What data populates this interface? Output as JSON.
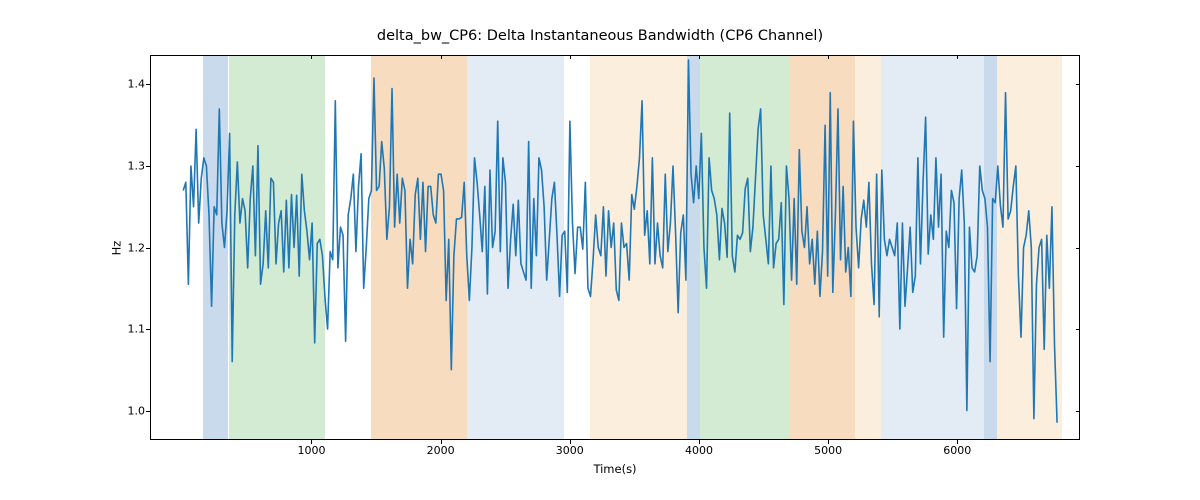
{
  "chart_data": {
    "type": "line",
    "title": "delta_bw_CP6: Delta Instantaneous Bandwidth (CP6 Channel)",
    "xlabel": "Time(s)",
    "ylabel": "Hz",
    "xlim": [
      -250,
      6950
    ],
    "ylim": [
      0.965,
      1.435
    ],
    "xticks": [
      1000,
      2000,
      3000,
      4000,
      5000,
      6000
    ],
    "yticks": [
      1.0,
      1.1,
      1.2,
      1.3,
      1.4
    ],
    "bands": [
      {
        "x0": 150,
        "x1": 350,
        "color": "#c9daec",
        "label": "blue"
      },
      {
        "x0": 350,
        "x1": 1100,
        "color": "#d3ead3",
        "label": "green"
      },
      {
        "x0": 1450,
        "x1": 2200,
        "color": "#f8dcc0",
        "label": "orange"
      },
      {
        "x0": 2200,
        "x1": 2950,
        "color": "#e3ebf4",
        "label": "lightblue"
      },
      {
        "x0": 3150,
        "x1": 3900,
        "color": "#fbeedd",
        "label": "peach"
      },
      {
        "x0": 3900,
        "x1": 4000,
        "color": "#c9daec",
        "label": "blue"
      },
      {
        "x0": 4000,
        "x1": 4700,
        "color": "#d3ead3",
        "label": "green"
      },
      {
        "x0": 4700,
        "x1": 5200,
        "color": "#f8dcc0",
        "label": "orange"
      },
      {
        "x0": 5200,
        "x1": 5400,
        "color": "#fbeedd",
        "label": "peach"
      },
      {
        "x0": 5400,
        "x1": 6200,
        "color": "#e3ebf4",
        "label": "lightblue"
      },
      {
        "x0": 6200,
        "x1": 6300,
        "color": "#c9daec",
        "label": "blue"
      },
      {
        "x0": 6300,
        "x1": 6800,
        "color": "#fbeedd",
        "label": "peach"
      }
    ],
    "series": [
      {
        "name": "delta_bw_CP6",
        "color": "#1f77b4",
        "x_start": 0,
        "x_step": 20,
        "values": [
          1.27,
          1.28,
          1.155,
          1.3,
          1.25,
          1.345,
          1.23,
          1.285,
          1.31,
          1.3,
          1.24,
          1.128,
          1.25,
          1.24,
          1.37,
          1.23,
          1.2,
          1.245,
          1.34,
          1.06,
          1.24,
          1.305,
          1.23,
          1.26,
          1.245,
          1.175,
          1.26,
          1.3,
          1.19,
          1.325,
          1.155,
          1.18,
          1.245,
          1.175,
          1.285,
          1.28,
          1.18,
          1.23,
          1.245,
          1.17,
          1.258,
          1.175,
          1.265,
          1.2,
          1.264,
          1.165,
          1.29,
          1.245,
          1.22,
          1.185,
          1.23,
          1.083,
          1.205,
          1.21,
          1.19,
          1.138,
          1.1,
          1.195,
          1.185,
          1.38,
          1.175,
          1.225,
          1.215,
          1.085,
          1.24,
          1.26,
          1.29,
          1.195,
          1.275,
          1.315,
          1.15,
          1.2,
          1.26,
          1.27,
          1.408,
          1.27,
          1.275,
          1.33,
          1.297,
          1.21,
          1.25,
          1.395,
          1.225,
          1.29,
          1.23,
          1.285,
          1.27,
          1.15,
          1.21,
          1.18,
          1.265,
          1.285,
          1.21,
          1.28,
          1.195,
          1.275,
          1.275,
          1.24,
          1.23,
          1.29,
          1.29,
          1.27,
          1.135,
          1.21,
          1.05,
          1.19,
          1.235,
          1.235,
          1.237,
          1.28,
          1.19,
          1.135,
          1.2,
          1.31,
          1.28,
          1.24,
          1.195,
          1.275,
          1.143,
          1.295,
          1.2,
          1.22,
          1.355,
          1.195,
          1.31,
          1.28,
          1.15,
          1.21,
          1.253,
          1.19,
          1.258,
          1.18,
          1.17,
          1.16,
          1.33,
          1.15,
          1.26,
          1.19,
          1.31,
          1.295,
          1.25,
          1.16,
          1.21,
          1.26,
          1.28,
          1.215,
          1.14,
          1.215,
          1.22,
          1.145,
          1.355,
          1.23,
          1.168,
          1.225,
          1.225,
          1.198,
          1.28,
          1.15,
          1.14,
          1.185,
          1.24,
          1.2,
          1.19,
          1.25,
          1.165,
          1.245,
          1.2,
          1.23,
          1.148,
          1.135,
          1.23,
          1.2,
          1.205,
          1.16,
          1.265,
          1.247,
          1.275,
          1.31,
          1.38,
          1.215,
          1.245,
          1.18,
          1.31,
          1.18,
          1.23,
          1.19,
          1.175,
          1.29,
          1.195,
          1.23,
          1.3,
          1.218,
          1.12,
          1.218,
          1.24,
          1.16,
          1.43,
          1.29,
          1.255,
          1.3,
          1.26,
          1.34,
          1.2,
          1.15,
          1.31,
          1.27,
          1.26,
          1.24,
          1.185,
          1.248,
          1.23,
          1.188,
          1.365,
          1.19,
          1.17,
          1.215,
          1.21,
          1.218,
          1.272,
          1.285,
          1.195,
          1.225,
          1.285,
          1.345,
          1.37,
          1.24,
          1.21,
          1.18,
          1.3,
          1.175,
          1.205,
          1.21,
          1.255,
          1.13,
          1.3,
          1.26,
          1.16,
          1.26,
          1.155,
          1.32,
          1.22,
          1.2,
          1.25,
          1.18,
          1.21,
          1.155,
          1.22,
          1.14,
          1.195,
          1.35,
          1.165,
          1.39,
          1.145,
          1.24,
          1.37,
          1.185,
          1.275,
          1.17,
          1.2,
          1.14,
          1.355,
          1.225,
          1.175,
          1.235,
          1.258,
          1.225,
          1.28,
          1.18,
          1.13,
          1.29,
          1.115,
          1.295,
          1.21,
          1.19,
          1.21,
          1.2,
          1.19,
          1.23,
          1.1,
          1.23,
          1.128,
          1.175,
          1.225,
          1.145,
          1.165,
          1.31,
          1.18,
          1.28,
          1.36,
          1.192,
          1.24,
          1.21,
          1.31,
          1.225,
          1.29,
          1.09,
          1.22,
          1.2,
          1.27,
          1.255,
          1.125,
          1.26,
          1.295,
          1.23,
          1.0,
          1.225,
          1.175,
          1.17,
          1.19,
          1.3,
          1.27,
          1.26,
          1.225,
          1.06,
          1.26,
          1.255,
          1.3,
          1.252,
          1.225,
          1.39,
          1.235,
          1.245,
          1.275,
          1.3,
          1.165,
          1.09,
          1.2,
          1.215,
          1.245,
          1.2,
          0.99,
          1.155,
          1.2,
          1.21,
          1.075,
          1.215,
          1.15,
          1.25,
          1.08,
          0.985
        ]
      }
    ]
  }
}
